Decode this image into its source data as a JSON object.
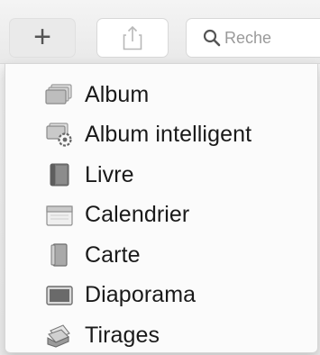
{
  "toolbar": {
    "add_symbol": "+",
    "search_placeholder": "Reche"
  },
  "menu": {
    "items": [
      {
        "label": "Album",
        "icon": "album-icon"
      },
      {
        "label": "Album intelligent",
        "icon": "smart-album-icon"
      },
      {
        "label": "Livre",
        "icon": "book-icon"
      },
      {
        "label": "Calendrier",
        "icon": "calendar-icon"
      },
      {
        "label": "Carte",
        "icon": "card-icon"
      },
      {
        "label": "Diaporama",
        "icon": "slideshow-icon"
      },
      {
        "label": "Tirages",
        "icon": "prints-icon"
      }
    ]
  }
}
